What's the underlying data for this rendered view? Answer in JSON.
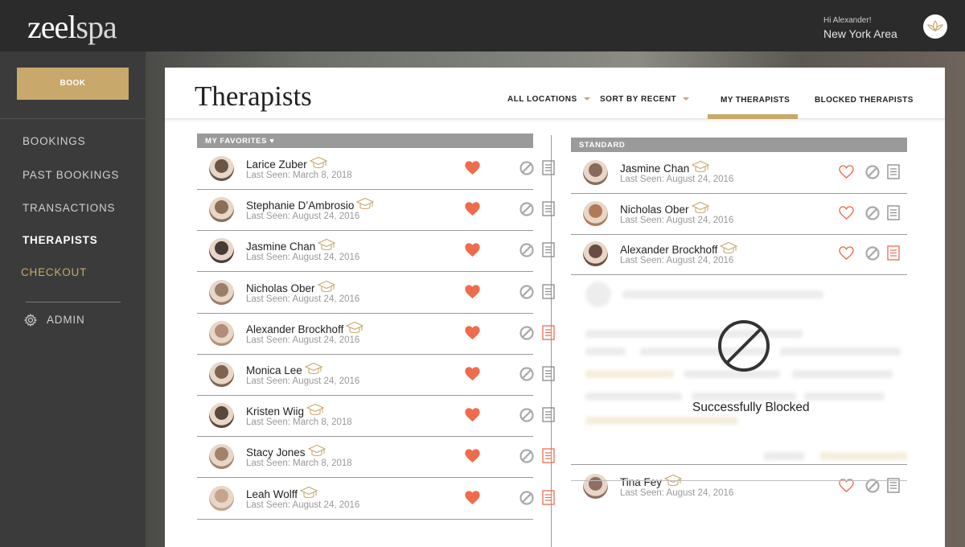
{
  "header": {
    "logo_main": "zeel",
    "logo_sub": "spa",
    "greeting": "Hi Alexander!",
    "location": "New York Area"
  },
  "sidebar": {
    "book_label": "BOOK",
    "items": [
      {
        "label": "BOOKINGS"
      },
      {
        "label": "PAST BOOKINGS"
      },
      {
        "label": "TRANSACTIONS"
      },
      {
        "label": "THERAPISTS",
        "active": true
      },
      {
        "label": "CHECKOUT",
        "accent": true
      }
    ],
    "admin_label": "ADMIN"
  },
  "page": {
    "title": "Therapists",
    "filters": {
      "locations": "ALL LOCATIONS",
      "sort": "SORT BY RECENT"
    },
    "tabs": [
      "MY THERAPISTS",
      "BLOCKED THERAPISTS"
    ],
    "active_tab": "MY THERAPISTS"
  },
  "favorites": {
    "heading": "MY FAVORITES ♥",
    "rows": [
      {
        "name": "Larice Zuber",
        "last_seen": "Last Seen: March 8, 2018",
        "note_highlight": false
      },
      {
        "name": "Stephanie D’Ambrosio",
        "last_seen": "Last Seen: August 24, 2016",
        "note_highlight": false
      },
      {
        "name": "Jasmine Chan",
        "last_seen": "Last Seen: August 24, 2016",
        "note_highlight": false
      },
      {
        "name": "Nicholas Ober",
        "last_seen": "Last Seen: August 24, 2016",
        "note_highlight": false
      },
      {
        "name": "Alexander Brockhoff",
        "last_seen": "Last Seen: August 24, 2016",
        "note_highlight": true
      },
      {
        "name": "Monica Lee",
        "last_seen": "Last Seen: August 24, 2016",
        "note_highlight": false
      },
      {
        "name": "Kristen Wiig",
        "last_seen": "Last Seen: March 8, 2018",
        "note_highlight": false
      },
      {
        "name": "Stacy Jones",
        "last_seen": "Last Seen: March 8, 2018",
        "note_highlight": true
      },
      {
        "name": "Leah Wolff",
        "last_seen": "Last Seen: August 24, 2016",
        "note_highlight": true
      }
    ]
  },
  "standard": {
    "heading": "STANDARD",
    "rows": [
      {
        "name": "Jasmine Chan",
        "last_seen": "Last Seen: August 24, 2016",
        "note_highlight": false
      },
      {
        "name": "Nicholas Ober",
        "last_seen": "Last Seen: August 24, 2016",
        "note_highlight": false
      },
      {
        "name": "Alexander Brockhoff",
        "last_seen": "Last Seen: August 24, 2016",
        "note_highlight": true
      }
    ],
    "trailing_row": {
      "name": "Tina Fey",
      "last_seen": "Last Seen: August 24, 2016",
      "note_highlight": false
    }
  },
  "overlay": {
    "message": "Successfully Blocked"
  },
  "colors": {
    "accent": "#c8a96b",
    "heart": "#ee6c4d",
    "sidebar_bg": "#3b3b3b",
    "topbar_bg": "#2b2b2b",
    "section_header": "#9a9a9a"
  }
}
